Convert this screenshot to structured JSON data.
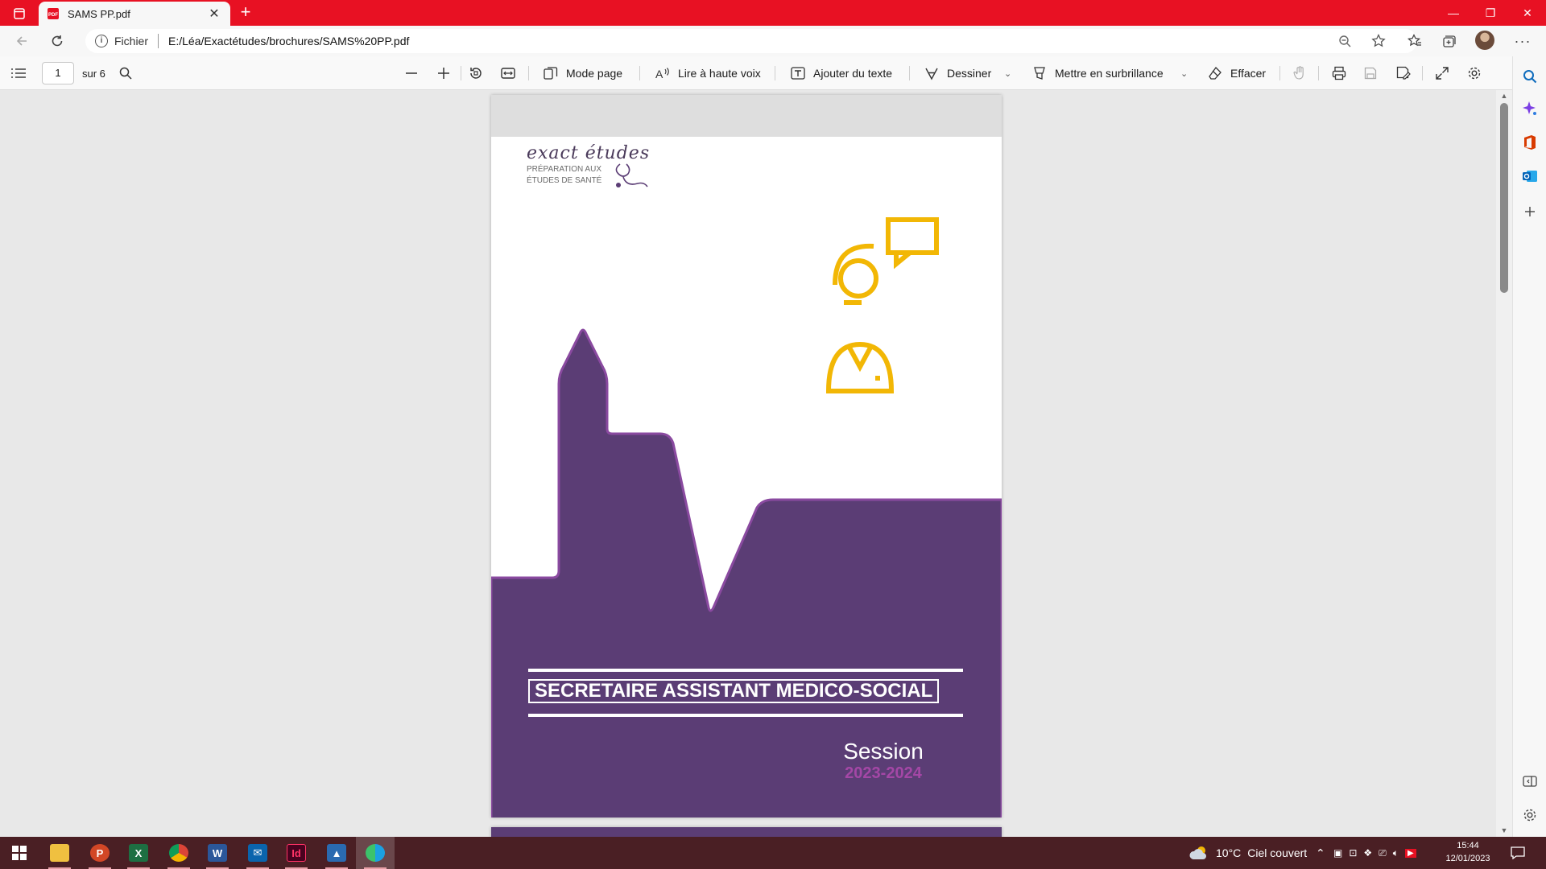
{
  "browser": {
    "tab_title": "SAMS PP.pdf",
    "address_scheme": "Fichier",
    "address_url": "E:/Léa/Exactétudes/brochures/SAMS%20PP.pdf"
  },
  "pdf_toolbar": {
    "page_current": "1",
    "page_total": "sur 6",
    "mode_page": "Mode page",
    "read_aloud": "Lire à haute voix",
    "add_text": "Ajouter du texte",
    "draw": "Dessiner",
    "highlight": "Mettre en surbrillance",
    "erase": "Effacer"
  },
  "document": {
    "brand_name": "exact études",
    "brand_sub_1": "PRÉPARATION AUX",
    "brand_sub_2": "ÉTUDES DE SANTÉ",
    "cover_title": "SECRETAIRE ASSISTANT MEDICO-SOCIAL",
    "session_label": "Session",
    "session_years": "2023-2024",
    "colors": {
      "purple": "#5b3d75",
      "purple_border": "#8a4aa0",
      "gold": "#f2b705",
      "magenta": "#a447a6"
    }
  },
  "taskbar": {
    "apps": [
      "file-explorer",
      "powerpoint",
      "excel",
      "chrome",
      "word",
      "mail",
      "indesign",
      "photos",
      "edge"
    ],
    "weather_temp": "10°C",
    "weather_text": "Ciel couvert",
    "time": "15:44",
    "date": "12/01/2023"
  }
}
